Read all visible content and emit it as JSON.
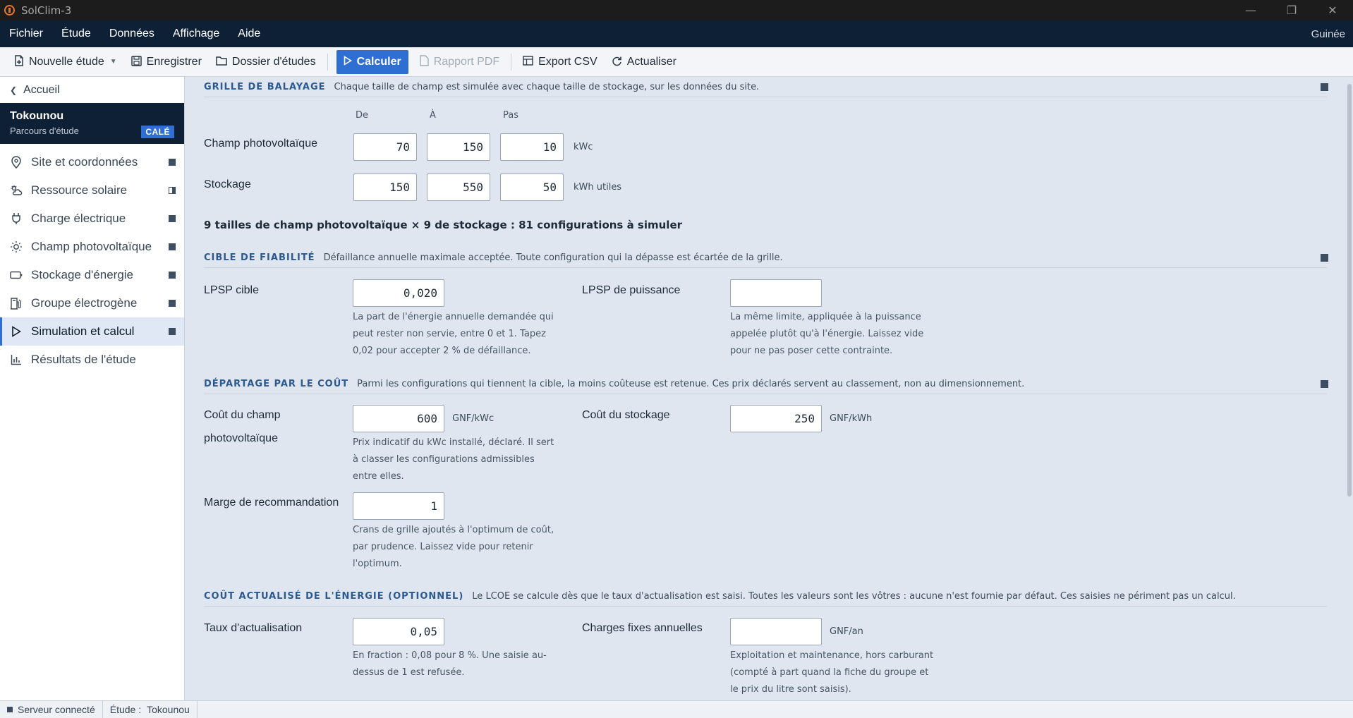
{
  "window": {
    "title": "SolClim-3",
    "minimize_glyph": "—",
    "maximize_glyph": "❐",
    "close_glyph": "✕"
  },
  "menu": {
    "items": [
      "Fichier",
      "Étude",
      "Données",
      "Affichage",
      "Aide"
    ],
    "region": "Guinée"
  },
  "toolbar": {
    "new_study": "Nouvelle étude",
    "save": "Enregistrer",
    "studies_folder": "Dossier d'études",
    "compute": "Calculer",
    "pdf_report": "Rapport PDF",
    "export_csv": "Export CSV",
    "refresh": "Actualiser"
  },
  "sidebar": {
    "back": "Accueil",
    "project": {
      "name": "Tokounou",
      "subtitle": "Parcours d'étude",
      "badge": "CALÉ"
    },
    "items": [
      {
        "label": "Site et coordonnées",
        "icon": "map-pin-icon",
        "state": "complete"
      },
      {
        "label": "Ressource solaire",
        "icon": "sun-cloud-icon",
        "state": "partial"
      },
      {
        "label": "Charge électrique",
        "icon": "plug-icon",
        "state": "complete"
      },
      {
        "label": "Champ photovoltaïque",
        "icon": "sun-icon",
        "state": "complete"
      },
      {
        "label": "Stockage d'énergie",
        "icon": "battery-icon",
        "state": "complete"
      },
      {
        "label": "Groupe électrogène",
        "icon": "fuel-pump-icon",
        "state": "complete"
      },
      {
        "label": "Simulation et calcul",
        "icon": "play-icon",
        "state": "complete",
        "active": true
      },
      {
        "label": "Résultats de l'étude",
        "icon": "bar-chart-icon",
        "state": "none"
      }
    ]
  },
  "grid": {
    "title": "GRILLE DE BALAYAGE",
    "description": "Chaque taille de champ est simulée avec chaque taille de stockage, sur les données du site.",
    "col_from": "De",
    "col_to": "À",
    "col_step": "Pas",
    "pv": {
      "label": "Champ photovoltaïque",
      "from": "70",
      "to": "150",
      "step": "10",
      "unit": "kWc"
    },
    "storage": {
      "label": "Stockage",
      "from": "150",
      "to": "550",
      "step": "50",
      "unit": "kWh utiles"
    },
    "summary": "9 tailles de champ photovoltaïque × 9 de stockage : 81 configurations à simuler"
  },
  "reliability": {
    "title": "CIBLE DE FIABILITÉ",
    "description": "Défaillance annuelle maximale acceptée. Toute configuration qui la dépasse est écartée de la grille.",
    "lpsp_label": "LPSP cible",
    "lpsp_value": "0,020",
    "lpsp_help": "La part de l'énergie annuelle demandée qui peut rester non servie, entre 0 et 1. Tapez 0,02 pour accepter 2 % de défaillance.",
    "power_label": "LPSP de puissance",
    "power_value": "",
    "power_help": "La même limite, appliquée à la puissance appelée plutôt qu'à l'énergie. Laissez vide pour ne pas poser cette contrainte."
  },
  "cost": {
    "title": "DÉPARTAGE PAR LE COÛT",
    "description": "Parmi les configurations qui tiennent la cible, la moins coûteuse est retenue. Ces prix déclarés servent au classement, non au dimensionnement.",
    "pv_label_line1": "Coût du champ",
    "pv_label_line2": "photovoltaïque",
    "pv_value": "600",
    "pv_unit": "GNF/kWc",
    "pv_help": "Prix indicatif du kWc installé, déclaré. Il sert à classer les configurations admissibles entre elles.",
    "storage_label": "Coût du stockage",
    "storage_value": "250",
    "storage_unit": "GNF/kWh",
    "margin_label": "Marge de recommandation",
    "margin_value": "1",
    "margin_help": "Crans de grille ajoutés à l'optimum de coût, par prudence. Laissez vide pour retenir l'optimum."
  },
  "lcoe": {
    "title": "COÛT ACTUALISÉ DE L'ÉNERGIE (OPTIONNEL)",
    "description": "Le LCOE se calcule dès que le taux d'actualisation est saisi. Toutes les valeurs sont les vôtres : aucune n'est fournie par défaut. Ces saisies ne périment pas un calcul.",
    "rate_label": "Taux d'actualisation",
    "rate_value": "0,05",
    "rate_help": "En fraction : 0,08 pour 8 %. Une saisie au-dessus de 1 est refusée.",
    "fixed_label": "Charges fixes annuelles",
    "fixed_value": "",
    "fixed_unit": "GNF/an",
    "fixed_help": "Exploitation et maintenance, hors carburant (compté à part quand la fiche du groupe et le prix du litre sont saisis)."
  },
  "status": {
    "server": "Serveur connecté",
    "study_label": "Étude :",
    "study_value": "Tokounou"
  }
}
